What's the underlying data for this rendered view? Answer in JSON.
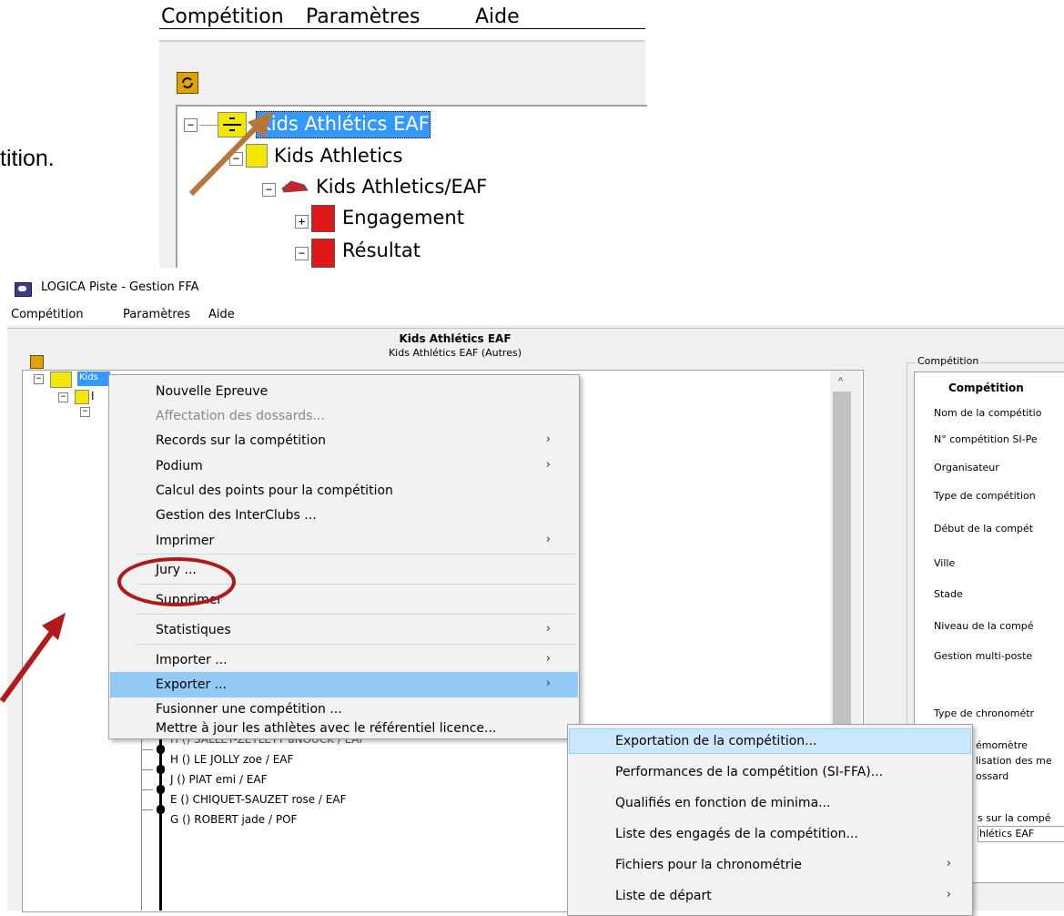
{
  "inset": {
    "menu": [
      "Compétition",
      "Paramètres",
      "Aide"
    ],
    "tree": {
      "root": "Kids Athlétics EAF",
      "child": "Kids Athletics",
      "grandchild": "Kids Athletics/EAF",
      "items": [
        "Engagement",
        "Résultat"
      ]
    },
    "caption_fragment": "tition."
  },
  "window": {
    "title": "LOGICA Piste - Gestion FFA",
    "menu": [
      "Compétition",
      "Paramètres",
      "Aide"
    ],
    "header_title": "Kids Athlétics EAF",
    "header_subtitle": "Kids Athlétics EAF (Autres)",
    "tree_root": "Kids",
    "tree_child_partial": "I",
    "athletes": [
      "H () SALLET-ZETLETT aNOUCK / EAF",
      "H () LE JOLLY zoe / EAF",
      "J () PIAT emi / EAF",
      "E () CHIQUET-SAUZET rose / EAF",
      "G () ROBERT jade / POF"
    ]
  },
  "context_menu": {
    "items": [
      {
        "label": "Nouvelle Epreuve",
        "submenu": false,
        "disabled": false
      },
      {
        "label": "Affectation des dossards...",
        "submenu": false,
        "disabled": true
      },
      {
        "label": "Records sur la compétition",
        "submenu": true,
        "disabled": false
      },
      {
        "label": "Podium",
        "submenu": true,
        "disabled": false
      },
      {
        "label": "Calcul des points pour la compétition",
        "submenu": false,
        "disabled": false
      },
      {
        "label": "Gestion des InterClubs ...",
        "submenu": false,
        "disabled": false
      },
      {
        "label": "Imprimer",
        "submenu": true,
        "disabled": false
      },
      {
        "label": "Jury ...",
        "submenu": false,
        "disabled": false
      },
      {
        "label": "Supprimer",
        "submenu": false,
        "disabled": false
      },
      {
        "label": "Statistiques",
        "submenu": true,
        "disabled": false
      },
      {
        "label": "Importer ...",
        "submenu": true,
        "disabled": false
      },
      {
        "label": "Exporter ...",
        "submenu": true,
        "disabled": false,
        "highlighted": true
      },
      {
        "label": "Fusionner une compétition ...",
        "submenu": false,
        "disabled": false
      },
      {
        "label": "Mettre à jour les athlètes avec le référentiel licence...",
        "submenu": false,
        "disabled": false
      }
    ]
  },
  "export_submenu": {
    "items": [
      {
        "label": "Exportation de la compétition...",
        "submenu": false,
        "highlighted": true
      },
      {
        "label": "Performances de la compétition (SI-FFA)...",
        "submenu": false
      },
      {
        "label": "Qualifiés en fonction de minima...",
        "submenu": false
      },
      {
        "label": "Liste des engagés de la compétition...",
        "submenu": false
      },
      {
        "label": "Fichiers pour la chronométrie",
        "submenu": true
      },
      {
        "label": "Liste de départ",
        "submenu": true
      }
    ]
  },
  "right_panel": {
    "group_label": "Compétition",
    "heading": "Compétition",
    "fields": [
      "Nom de la compétitio",
      "N° compétition SI-Pe",
      "Organisateur",
      "Type de compétition",
      "Début de la compét",
      "Ville",
      "Stade",
      "Niveau de la compé",
      "Gestion multi-poste",
      "Type de chronométr",
      "émomètre",
      "lisation des me",
      "ossard",
      "s sur la compé",
      "hlétics EAF"
    ]
  },
  "annotations": {
    "arrow_color": "#b5773a",
    "arrow_red_color": "#b01a1a",
    "circle_color": "#b01a1a"
  }
}
